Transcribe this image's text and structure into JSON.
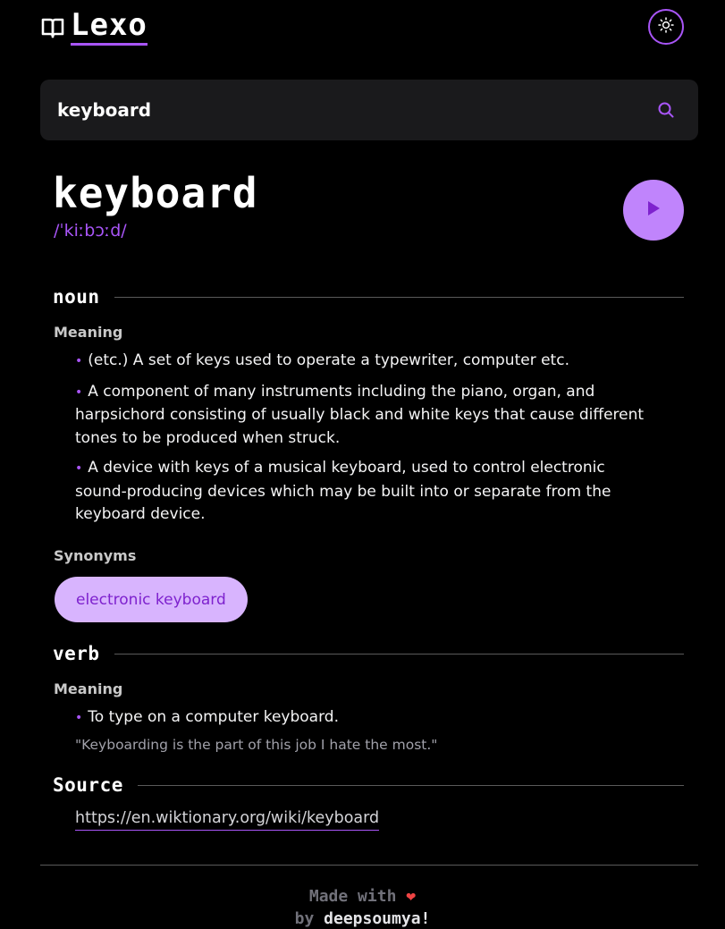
{
  "header": {
    "logo_text": "Lexo",
    "icons": {
      "logo": "book-icon",
      "theme_toggle": "sun-icon"
    }
  },
  "search": {
    "value": "keyboard",
    "placeholder": "",
    "icon": "search-icon"
  },
  "entry": {
    "word": "keyboard",
    "phonetic": "/ˈkiːbɔːd/",
    "play_icon": "play-icon"
  },
  "noun": {
    "title": "noun",
    "meaning_label": "Meaning",
    "definitions": [
      "(etc.) A set of keys used to operate a typewriter, computer etc.",
      "A component of many instruments including the piano, organ, and harpsichord consisting of usually black and white keys that cause different tones to be produced when struck.",
      "A device with keys of a musical keyboard, used to control electronic sound-producing devices which may be built into or separate from the keyboard device."
    ],
    "synonyms_label": "Synonyms",
    "synonyms": [
      "electronic keyboard"
    ]
  },
  "verb": {
    "title": "verb",
    "meaning_label": "Meaning",
    "definitions": [
      "To type on a computer keyboard."
    ],
    "example": "\"Keyboarding is the part of this job I hate the most.\""
  },
  "source": {
    "title": "Source",
    "url": "https://en.wiktionary.org/wiki/keyboard"
  },
  "footer": {
    "line1": "Made with",
    "line2_prefix": "by",
    "author": "deepsoumya!"
  },
  "colors": {
    "background": "#000000",
    "accent": "#a855f7",
    "search_bg": "#1a1a1c",
    "play_button": "#c084fc",
    "chip_bg": "#d8b4fe",
    "chip_text": "#7e22ce",
    "heart": "#ef4444"
  }
}
